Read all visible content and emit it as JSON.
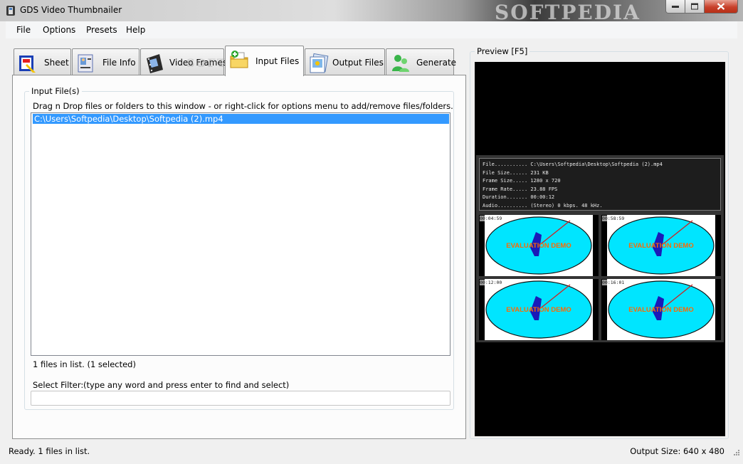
{
  "window": {
    "title": "GDS Video Thumbnailer",
    "watermark": "SOFTPEDIA"
  },
  "menu": [
    "File",
    "Options",
    "Presets",
    "Help"
  ],
  "tabs": [
    {
      "label": "Sheet",
      "icon": "sheet-icon"
    },
    {
      "label": "File Info",
      "icon": "file-info-icon"
    },
    {
      "label": "Video Frames",
      "icon": "film-icon"
    },
    {
      "label": "Input Files",
      "icon": "folder-add-icon",
      "active": true
    },
    {
      "label": "Output Files",
      "icon": "picture-icon"
    },
    {
      "label": "Generate",
      "icon": "generate-icon"
    }
  ],
  "input_files": {
    "legend": "Input File(s)",
    "instructions": "Drag n Drop files or folders to this window - or right-click for options menu to add/remove files/folders.",
    "files": [
      "C:\\Users\\Softpedia\\Desktop\\Softpedia (2).mp4"
    ],
    "count_text": "1 files in list. (1 selected)",
    "filter_label": "Select Filter:",
    "filter_hint": "(type any word and press enter to find and select)",
    "filter_value": ""
  },
  "preview": {
    "legend": "Preview  [F5]",
    "info_lines": [
      "File........... C:\\Users\\Softpedia\\Desktop\\Softpedia (2).mp4",
      "File Size...... 231 KB",
      "Frame Size..... 1280 x 720",
      "Frame Rate..... 23.88 FPS",
      "Duration....... 00:00:12",
      "Audio.......... (Stereo) 0 kbps. 48 kHz."
    ],
    "thumbnails": [
      {
        "timestamp": "00:04:59",
        "text": "EVALUATION DEMO"
      },
      {
        "timestamp": "00:58:59",
        "text": "EVALUATION DEMO"
      },
      {
        "timestamp": "00:12:00",
        "text": "EVALUATION DEMO"
      },
      {
        "timestamp": "00:16:01",
        "text": "EVALUATION DEMO"
      }
    ]
  },
  "statusbar": {
    "left": "Ready. 1 files in list.",
    "right": "Output Size: 640 x 480"
  },
  "colors": {
    "selection": "#3399ff",
    "thumb_face": "#00e5ff",
    "demo_text": "#ff6a00",
    "close_red": "#c8402b"
  }
}
